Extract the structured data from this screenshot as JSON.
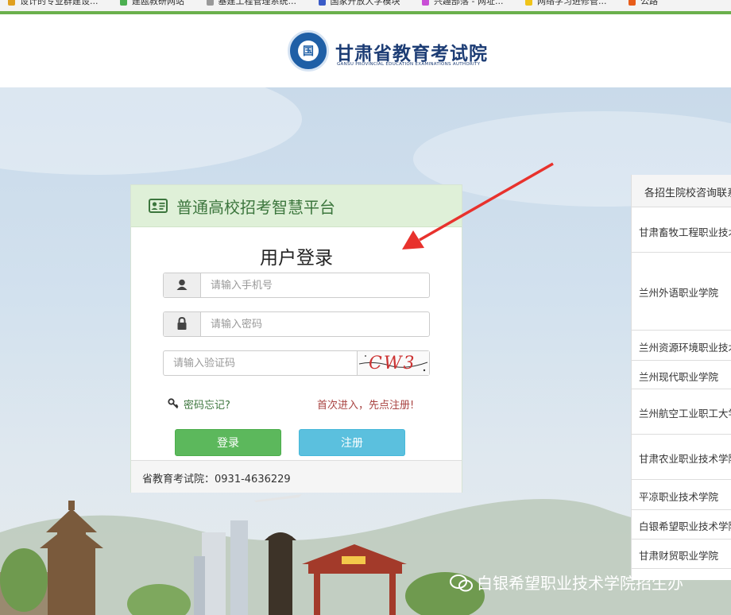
{
  "bookmarks": [
    "设计的专业群建设...",
    "建瓯教研网站",
    "基建工程管理系统...",
    "国家开放大学模块",
    "兴趣部落 - 网址...",
    "网络学习进修管...",
    "公路"
  ],
  "header": {
    "logo_text": "甘肃省教育考试院",
    "logo_subtext": "GANSU PROVINCIAL EDUCATION EXAMINATIONS AUTHORITY",
    "emblem_glyph": "国"
  },
  "login": {
    "platform_title": "普通高校招考智慧平台",
    "form_title": "用户登录",
    "phone_placeholder": "请输入手机号",
    "password_placeholder": "请输入密码",
    "captcha_placeholder": "请输入验证码",
    "captcha_text": "CW3",
    "forgot_label": "密码忘记?",
    "register_prompt": "首次进入，先点注册!",
    "login_button": "登录",
    "register_button": "注册",
    "footer": "省教育考试院：0931-4636229"
  },
  "side_panel": {
    "title": "各招生院校咨询联系",
    "items": [
      "甘肃畜牧工程职业技术学院",
      "兰州外语职业学院",
      "兰州资源环境职业技术学院",
      "兰州现代职业学院",
      "兰州航空工业职工大学",
      "甘肃农业职业技术学院",
      "平凉职业技术学院",
      "白银希望职业技术学院",
      "甘肃财贸职业学院"
    ]
  },
  "watermark": "白银希望职业技术学院招生办",
  "colors": {
    "accent_green": "#5cb85c",
    "accent_blue": "#5bc0de",
    "header_green": "#dff0d8",
    "arrow_red": "#e8322d",
    "brand_navy": "#1d3d75"
  },
  "icons": {
    "card": "id-card-icon",
    "phone": "user-icon",
    "password": "lock-icon",
    "forgot": "key-icon",
    "watermark": "wechat-icon"
  }
}
